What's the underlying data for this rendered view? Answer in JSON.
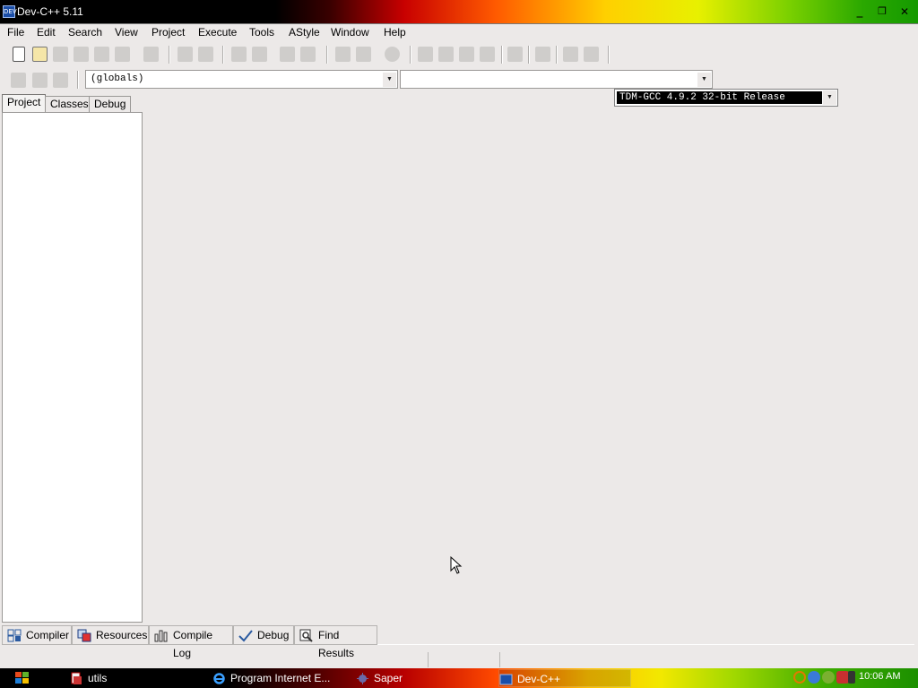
{
  "window": {
    "title": "Dev-C++ 5.11",
    "icon_text": "DEV"
  },
  "menu": [
    "File",
    "Edit",
    "Search",
    "View",
    "Project",
    "Execute",
    "Tools",
    "AStyle",
    "Window",
    "Help"
  ],
  "compiler": {
    "selected": "TDM-GCC 4.9.2 32-bit Release"
  },
  "scope": {
    "value": "(globals)",
    "function_value": ""
  },
  "left_tabs": [
    "Project",
    "Classes",
    "Debug"
  ],
  "bottom_tabs": [
    "Compiler",
    "Resources",
    "Compile Log",
    "Debug",
    "Find Results"
  ],
  "taskbar": {
    "items": [
      "utils",
      "Program Internet E...",
      "Saper",
      "Dev-C++"
    ],
    "clock": "10:06 AM"
  }
}
